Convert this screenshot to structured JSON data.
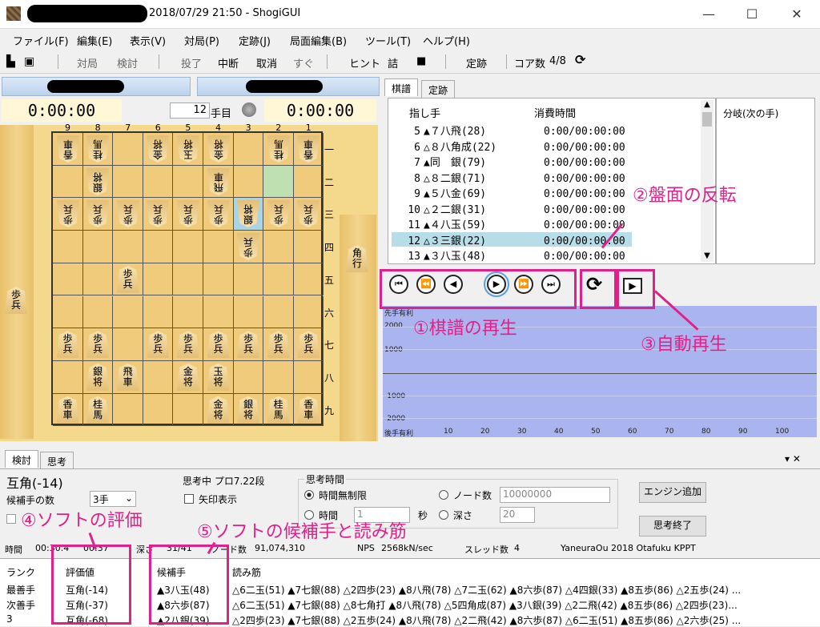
{
  "window": {
    "title": "2018/07/29 21:50 - ShogiGUI",
    "minimize": "—",
    "maximize": "☐",
    "close": "✕"
  },
  "menu": [
    "ファイル(F)",
    "編集(E)",
    "表示(V)",
    "対局(P)",
    "定跡(J)",
    "局面編集(B)",
    "ツール(T)",
    "ヘルプ(H)"
  ],
  "toolbar": [
    "対局",
    "検討",
    "投了",
    "中断",
    "取消",
    "すぐ",
    "ヒント",
    "詰",
    "■",
    "定跡",
    "コア数",
    "4/8"
  ],
  "clocks": {
    "left": "0:00:00",
    "right": "0:00:00",
    "move_number": "12",
    "move_suffix": "手目"
  },
  "board": {
    "files": [
      "9",
      "8",
      "7",
      "6",
      "5",
      "4",
      "3",
      "2",
      "1"
    ],
    "ranks": [
      "一",
      "二",
      "三",
      "四",
      "五",
      "六",
      "七",
      "八",
      "九"
    ],
    "pieces": [
      {
        "r": 0,
        "f": 0,
        "t": "香\n車",
        "g": true
      },
      {
        "r": 0,
        "f": 1,
        "t": "桂\n馬",
        "g": true
      },
      {
        "r": 0,
        "f": 3,
        "t": "金\n将",
        "g": true
      },
      {
        "r": 0,
        "f": 4,
        "t": "玉\n将",
        "g": true
      },
      {
        "r": 0,
        "f": 5,
        "t": "金\n将",
        "g": true
      },
      {
        "r": 0,
        "f": 7,
        "t": "桂\n馬",
        "g": true
      },
      {
        "r": 0,
        "f": 8,
        "t": "香\n車",
        "g": true
      },
      {
        "r": 1,
        "f": 1,
        "t": "銀\n将",
        "g": true
      },
      {
        "r": 1,
        "f": 5,
        "t": "飛\n車",
        "g": true
      },
      {
        "r": 2,
        "f": 0,
        "t": "歩\n兵",
        "g": true
      },
      {
        "r": 2,
        "f": 1,
        "t": "歩\n兵",
        "g": true
      },
      {
        "r": 2,
        "f": 2,
        "t": "歩\n兵",
        "g": true
      },
      {
        "r": 2,
        "f": 3,
        "t": "歩\n兵",
        "g": true
      },
      {
        "r": 2,
        "f": 4,
        "t": "歩\n兵",
        "g": true
      },
      {
        "r": 2,
        "f": 5,
        "t": "歩\n兵",
        "g": true
      },
      {
        "r": 2,
        "f": 6,
        "t": "銀\n将",
        "g": true
      },
      {
        "r": 2,
        "f": 7,
        "t": "歩\n兵",
        "g": true
      },
      {
        "r": 2,
        "f": 8,
        "t": "歩\n兵",
        "g": true
      },
      {
        "r": 3,
        "f": 6,
        "t": "歩\n兵",
        "g": true
      },
      {
        "r": 4,
        "f": 2,
        "t": "歩\n兵",
        "g": false
      },
      {
        "r": 6,
        "f": 0,
        "t": "歩\n兵",
        "g": false
      },
      {
        "r": 6,
        "f": 1,
        "t": "歩\n兵",
        "g": false
      },
      {
        "r": 6,
        "f": 3,
        "t": "歩\n兵",
        "g": false
      },
      {
        "r": 6,
        "f": 4,
        "t": "歩\n兵",
        "g": false
      },
      {
        "r": 6,
        "f": 5,
        "t": "歩\n兵",
        "g": false
      },
      {
        "r": 6,
        "f": 6,
        "t": "歩\n兵",
        "g": false
      },
      {
        "r": 6,
        "f": 7,
        "t": "歩\n兵",
        "g": false
      },
      {
        "r": 6,
        "f": 8,
        "t": "歩\n兵",
        "g": false
      },
      {
        "r": 7,
        "f": 1,
        "t": "銀\n将",
        "g": false
      },
      {
        "r": 7,
        "f": 2,
        "t": "飛\n車",
        "g": false
      },
      {
        "r": 7,
        "f": 4,
        "t": "金\n将",
        "g": false
      },
      {
        "r": 7,
        "f": 5,
        "t": "玉\n将",
        "g": false
      },
      {
        "r": 8,
        "f": 0,
        "t": "香\n車",
        "g": false
      },
      {
        "r": 8,
        "f": 1,
        "t": "桂\n馬",
        "g": false
      },
      {
        "r": 8,
        "f": 5,
        "t": "金\n将",
        "g": false
      },
      {
        "r": 8,
        "f": 6,
        "t": "銀\n将",
        "g": false
      },
      {
        "r": 8,
        "f": 7,
        "t": "桂\n馬",
        "g": false
      },
      {
        "r": 8,
        "f": 8,
        "t": "香\n車",
        "g": false
      }
    ],
    "hand_right": "角\n行",
    "hand_left": "歩\n兵"
  },
  "kifu": {
    "tabs": [
      "棋譜",
      "定跡"
    ],
    "col_move": "指し手",
    "col_time": "消費時間",
    "branch_header": "分岐(次の手)",
    "rows": [
      {
        "n": "5",
        "m": "▲７八飛(28)",
        "t": "0:00/00:00:00"
      },
      {
        "n": "6",
        "m": "△８八角成(22)",
        "t": "0:00/00:00:00"
      },
      {
        "n": "7",
        "m": "▲同　銀(79)",
        "t": "0:00/00:00:00"
      },
      {
        "n": "8",
        "m": "△８二銀(71)",
        "t": "0:00/00:00:00"
      },
      {
        "n": "9",
        "m": "▲５八金(69)",
        "t": "0:00/00:00:00"
      },
      {
        "n": "10",
        "m": "△２二銀(31)",
        "t": "0:00/00:00:00"
      },
      {
        "n": "11",
        "m": "▲４八玉(59)",
        "t": "0:00/00:00:00"
      },
      {
        "n": "12",
        "m": "△３三銀(22)",
        "t": "0:00/00:00:00"
      },
      {
        "n": "13",
        "m": "▲３八玉(48)",
        "t": "0:00/00:00:00"
      }
    ],
    "selected_index": 7
  },
  "nav": [
    "⏮",
    "⏪",
    "◀",
    "▶",
    "⏩",
    "⏭"
  ],
  "graph": {
    "labels_y": [
      "先手有利",
      "2000",
      "1000",
      "-1000",
      "-2000",
      "後手有利"
    ],
    "labels_x": [
      "10",
      "20",
      "30",
      "40",
      "50",
      "60",
      "70",
      "80",
      "90",
      "100"
    ]
  },
  "annotations": {
    "a1": "①棋譜の再生",
    "a2": "②盤面の反転",
    "a3": "③自動再生",
    "a4": "④ソフトの評価",
    "a5": "⑤ソフトの候補手と読み筋"
  },
  "analysis": {
    "tabs": [
      "検討",
      "思考"
    ],
    "evaluation": "互角(-14)",
    "candidates_label": "候補手の数",
    "candidates_value": "3手",
    "thinking": "思考中 プロ7.22段",
    "arrow_display": "矢印表示",
    "time_group": "思考時間",
    "unlimited": "時間無制限",
    "time": "時間",
    "time_val": "1",
    "sec": "秒",
    "nodes": "ノード数",
    "nodes_val": "10000000",
    "depth": "深さ",
    "depth_val": "20",
    "add_engine": "エンジン追加",
    "stop": "思考終了",
    "status": {
      "time_label": "時間",
      "t1": "00:30.4",
      "t2": "00:37",
      "depth_label": "深さ",
      "depth": "31/41",
      "nodes_label": "ノード数",
      "nodes": "91,074,310",
      "nps_label": "NPS",
      "nps": "2568kN/sec",
      "threads_label": "スレッド数",
      "threads": "4",
      "engine": "YaneuraOu 2018 Otafuku KPPT"
    }
  },
  "pv": {
    "headers": [
      "ランク",
      "評価値",
      "候補手",
      "読み筋"
    ],
    "rows": [
      {
        "rank": "最善手",
        "eval": "互角(-14)",
        "move": "▲3八玉(48)",
        "pv": "△6二玉(51) ▲7七銀(88) △2四歩(23) ▲8八飛(78) △7二玉(62) ▲8六歩(87) △4四銀(33) ▲8五歩(86) △2五歩(24) ..."
      },
      {
        "rank": "次善手",
        "eval": "互角(-37)",
        "move": "▲8六歩(87)",
        "pv": "△6二玉(51) ▲7七銀(88) △8七角打 ▲8八飛(78) △5四角成(87) ▲3八銀(39) △2二飛(42) ▲8五歩(86) △2四歩(23)..."
      },
      {
        "rank": "3",
        "eval": "互角(-68)",
        "move": "▲2八銀(39)",
        "pv": "△2四歩(23) ▲7七銀(88) △2五歩(24) ▲8八飛(78) △2二飛(42) ▲8六歩(87) △6二玉(51) ▲8五歩(86) △2六歩(25) ..."
      }
    ]
  }
}
